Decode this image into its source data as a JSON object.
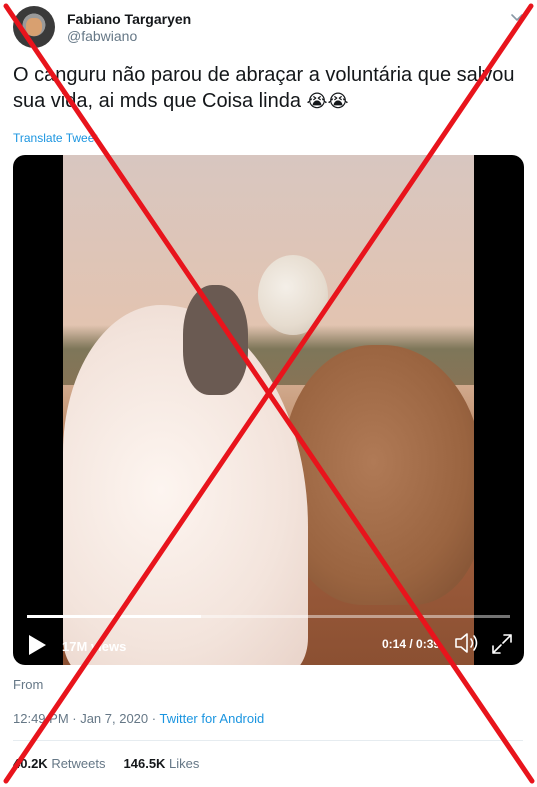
{
  "author": {
    "name": "Fabiano Targaryen",
    "handle": "@fabwiano"
  },
  "tweet": {
    "text": "O canguru não parou de abraçar a voluntária que salvou sua vida, ai mds que Coisa linda",
    "emojis": "😭😭",
    "translate_label": "Translate Tweet"
  },
  "video": {
    "views": "17M views",
    "time": "0:14 / 0:39",
    "progress": 0.36
  },
  "from_label": "From",
  "meta": {
    "timestamp": "12:49 PM · Jan 7, 2020 · ",
    "client": "Twitter for Android"
  },
  "stats": {
    "retweets_count": "40.2K",
    "retweets_label": " Retweets",
    "likes_count": "146.5K",
    "likes_label": " Likes"
  },
  "overlay": {
    "color": "#e8141c"
  }
}
